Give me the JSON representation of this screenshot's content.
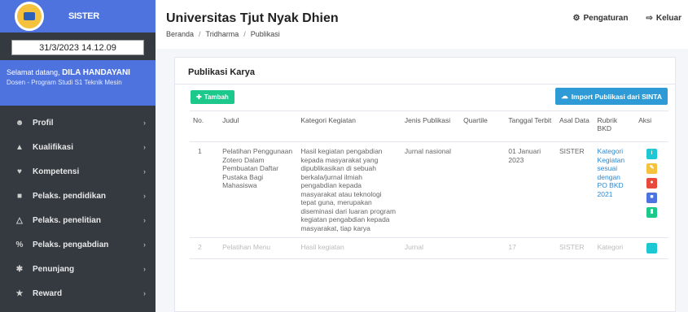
{
  "sidebar": {
    "brand": "SISTER",
    "datetime": "31/3/2023 14.12.09",
    "welcome_prefix": "Selamat datang,",
    "user_name": "DILA HANDAYANI",
    "role": "Dosen - Program Studi S1 Teknik Mesin",
    "items": [
      {
        "label": "Profil",
        "icon": "user-icon"
      },
      {
        "label": "Kualifikasi",
        "icon": "graduation-icon"
      },
      {
        "label": "Kompetensi",
        "icon": "handshake-icon"
      },
      {
        "label": "Pelaks. pendidikan",
        "icon": "book-icon"
      },
      {
        "label": "Pelaks. penelitian",
        "icon": "flask-icon"
      },
      {
        "label": "Pelaks. pengabdian",
        "icon": "percent-icon"
      },
      {
        "label": "Penunjang",
        "icon": "gear-icon"
      },
      {
        "label": "Reward",
        "icon": "trophy-icon"
      }
    ]
  },
  "header": {
    "title": "Universitas Tjut Nyak Dhien",
    "breadcrumb": [
      "Beranda",
      "Tridharma",
      "Publikasi"
    ],
    "settings_label": "Pengaturan",
    "logout_label": "Keluar"
  },
  "card": {
    "title": "Publikasi Karya",
    "add_label": "Tambah",
    "import_label": "Import Publikasi dari SINTA"
  },
  "table": {
    "columns": [
      "No.",
      "Judul",
      "Kategori Kegiatan",
      "Jenis Publikasi",
      "Quartile",
      "Tanggal Terbit",
      "Asal Data",
      "Rubrik BKD",
      "Aksi"
    ],
    "rows": [
      {
        "no": "1",
        "judul": "Pelatihan Penggunaan Zotero Dalam Pembuatan Daftar Pustaka Bagi Mahasiswa",
        "kategori": "Hasil kegiatan pengabdian kepada masyarakat yang dipublikasikan di sebuah berkala/jurnal ilmiah pengabdian kepada masyarakat atau teknologi tepat guna, merupakan diseminasi dari luaran program kegiatan pengabdian kepada masyarakat, tiap karya",
        "jenis": "Jurnal nasional",
        "quartile": "",
        "tanggal": "01 Januari 2023",
        "asal": "SISTER",
        "rubrik": "Kategori Kegiatan sesuai dengan PO BKD 2021"
      },
      {
        "no": "2",
        "judul": "Pelatihan Menu",
        "kategori": "Hasil kegiatan",
        "jenis": "Jurnal",
        "quartile": "",
        "tanggal": "17",
        "asal": "SISTER",
        "rubrik": "Kategori"
      }
    ]
  },
  "colors": {
    "sidebar_bg": "#343a40",
    "brand_blue": "#4e73df",
    "add_green": "#1cc88a",
    "import_blue": "#2e9bd6",
    "action_info": "#1cc8d3",
    "action_edit": "#f6c23e",
    "action_delete": "#e74a3b",
    "action_doc": "#4e73df",
    "action_file": "#1cc88a"
  }
}
